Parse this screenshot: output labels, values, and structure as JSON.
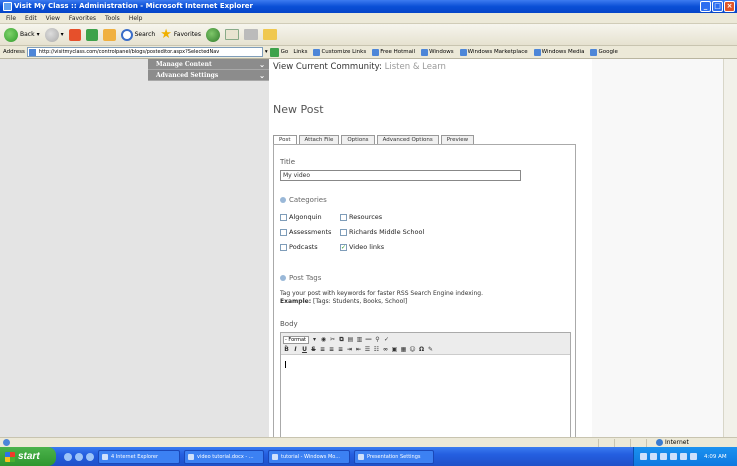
{
  "window": {
    "title": "Visit My Class :: Administration - Microsoft Internet Explorer"
  },
  "menu": [
    "File",
    "Edit",
    "View",
    "Favorites",
    "Tools",
    "Help"
  ],
  "toolbar": {
    "back": "Back",
    "search": "Search",
    "favorites": "Favorites"
  },
  "address": {
    "label": "Address",
    "url": "http://visitmyclass.com/controlpanel/blogs/posteditor.aspx?SelectedNav",
    "go": "Go",
    "links_label": "Links",
    "links": [
      "Customize Links",
      "Free Hotmail",
      "Windows",
      "Windows Marketplace",
      "Windows Media",
      "Google"
    ]
  },
  "sidebar": {
    "items": [
      {
        "label": "Manage Content"
      },
      {
        "label": "Advanced Settings"
      }
    ]
  },
  "main": {
    "community_label": "View Current Community:",
    "community_name": "Listen & Learn",
    "page_title": "New Post",
    "tabs": [
      "Post",
      "Attach File",
      "Options",
      "Advanced Options",
      "Preview"
    ],
    "title_label": "Title",
    "title_value": "My video",
    "categories_label": "Categories",
    "categories": [
      {
        "label": "Algonquin",
        "checked": false
      },
      {
        "label": "Resources",
        "checked": false
      },
      {
        "label": "Assessments",
        "checked": false
      },
      {
        "label": "Richards Middle School",
        "checked": false
      },
      {
        "label": "Podcasts",
        "checked": false
      },
      {
        "label": "Video links",
        "checked": true
      }
    ],
    "post_tags_label": "Post Tags",
    "post_tags_help": "Tag your post with keywords for faster RSS Search Engine indexing.",
    "example_label": "Example:",
    "example_text": "[Tags: Students, Books, School]",
    "body_label": "Body",
    "format_select": "- Format -"
  },
  "status": {
    "zone": "Internet"
  },
  "taskbar": {
    "start": "start",
    "buttons": [
      "4 Internet Explorer",
      "video tutorial.docx - ...",
      "tutorial - Windows Mo...",
      "Presentation Settings"
    ],
    "clock": "4:09 AM"
  }
}
